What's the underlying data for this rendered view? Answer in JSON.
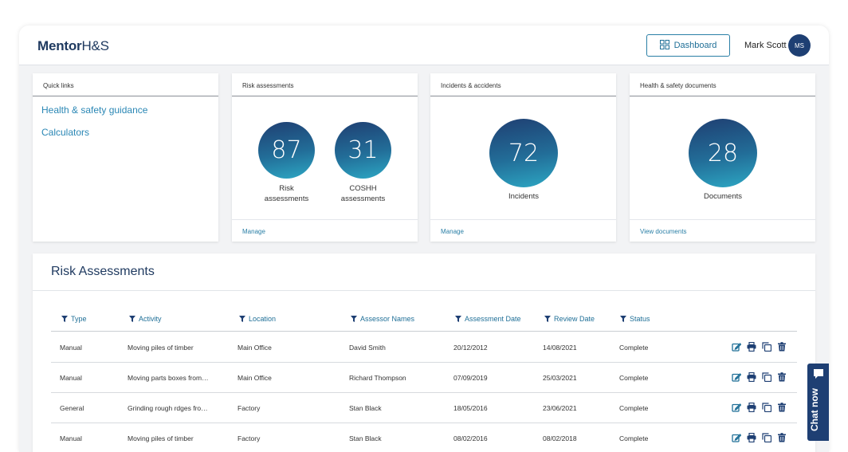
{
  "header": {
    "logo_bold": "Mentor",
    "logo_light": "H&S",
    "dashboard_label": "Dashboard",
    "user_name": "Mark Scott",
    "user_initials": "MS"
  },
  "quick_links": {
    "title": "Quick links",
    "items": [
      "Health & safety guidance",
      "Calculators"
    ]
  },
  "risk_card": {
    "title": "Risk assessments",
    "risk_count": "87",
    "risk_label_1": "Risk",
    "risk_label_2": "assessments",
    "coshh_count": "31",
    "coshh_label_1": "COSHH",
    "coshh_label_2": "assessments",
    "footer": "Manage"
  },
  "incidents_card": {
    "title": "Incidents & accidents",
    "count": "72",
    "label": "Incidents",
    "footer": "Manage"
  },
  "docs_card": {
    "title": "Health & safety documents",
    "count": "28",
    "label": "Documents",
    "footer": "View documents"
  },
  "risk_table": {
    "title": "Risk Assessments",
    "columns": [
      "Type",
      "Activity",
      "Location",
      "Assessor Names",
      "Assessment Date",
      "Review Date",
      "Status"
    ],
    "rows": [
      [
        "Manual",
        "Moving piles of timber",
        "Main Office",
        "David Smith",
        "20/12/2012",
        "14/08/2021",
        "Complete"
      ],
      [
        "Manual",
        "Moving parts boxes from…",
        "Main Office",
        "Richard Thompson",
        "07/09/2019",
        "25/03/2021",
        "Complete"
      ],
      [
        "General",
        "Grinding rough rdges fro…",
        "Factory",
        "Stan Black",
        "18/05/2016",
        "23/06/2021",
        "Complete"
      ],
      [
        "Manual",
        "Moving piles of timber",
        "Factory",
        "Stan Black",
        "08/02/2016",
        "08/02/2018",
        "Complete"
      ]
    ],
    "row_actions": [
      "edit-icon",
      "print-icon",
      "copy-icon",
      "delete-icon"
    ]
  },
  "chat": {
    "label": "Chat now"
  },
  "colors": {
    "accent": "#2a7fa6",
    "navy": "#1e3f73"
  }
}
